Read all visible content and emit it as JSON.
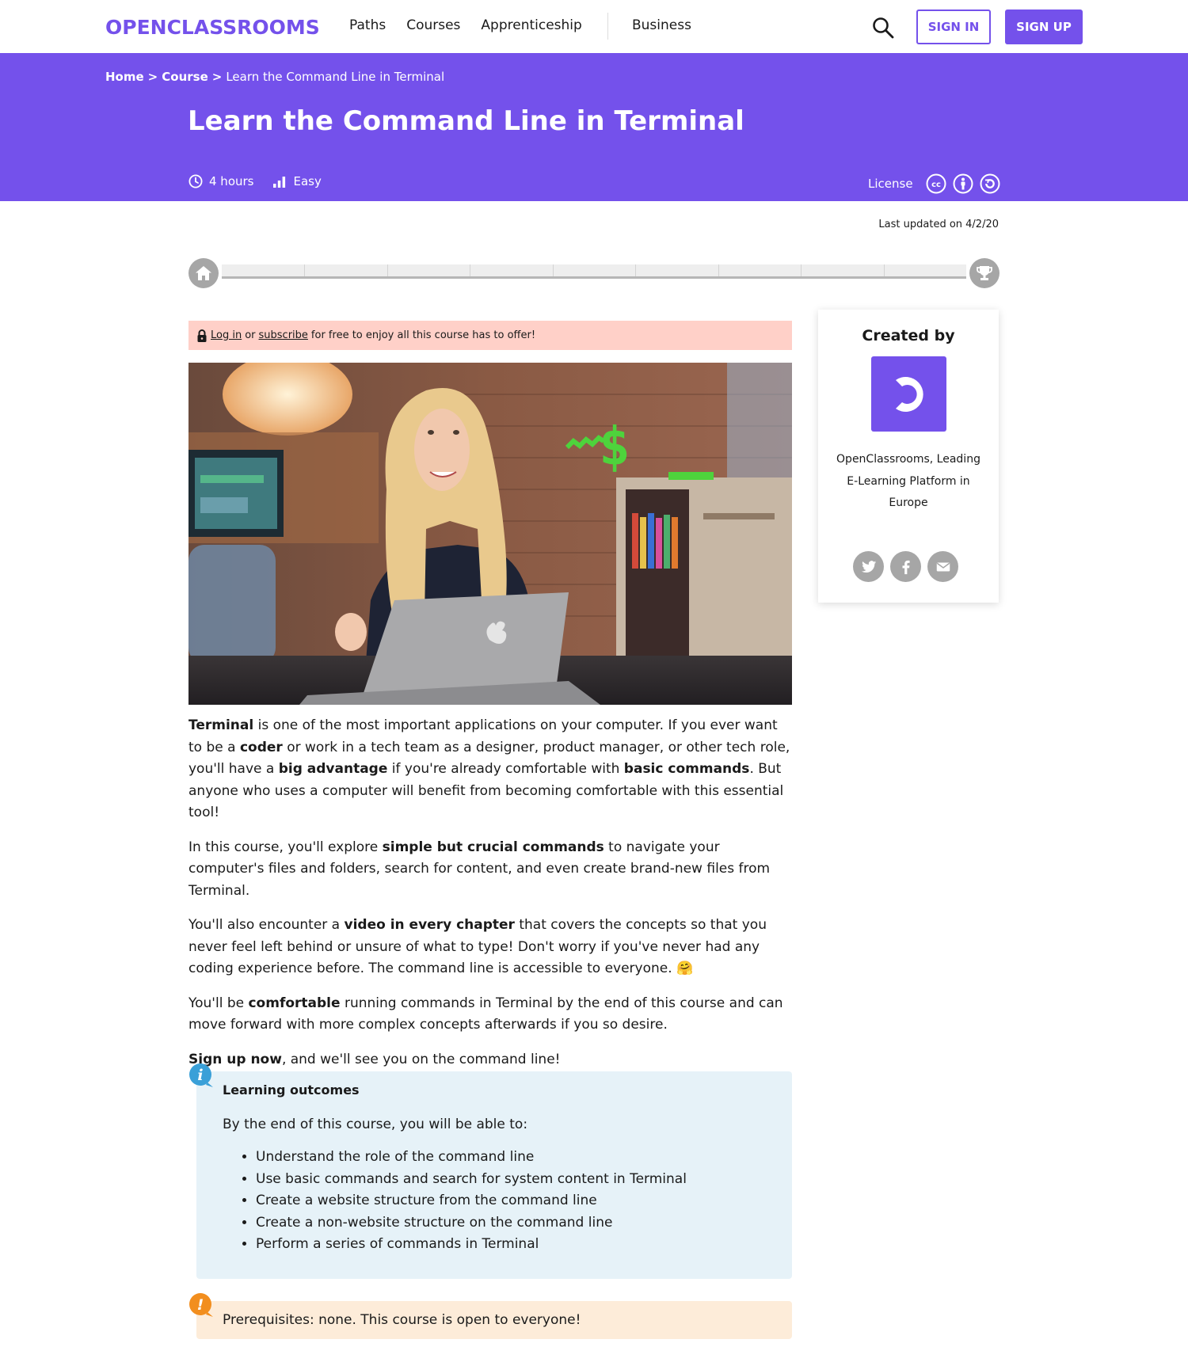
{
  "header": {
    "logo": "OPENCLASSROOMS",
    "nav": [
      "Paths",
      "Courses",
      "Apprenticeship"
    ],
    "business": "Business",
    "search_icon": "search-icon",
    "sign_in": "SIGN IN",
    "sign_up": "SIGN UP"
  },
  "breadcrumb": {
    "home": "Home",
    "separator": ">",
    "course": "Course",
    "current": "Learn the Command Line in Terminal"
  },
  "course": {
    "title": "Learn the Command Line in Terminal",
    "duration": "4 hours",
    "difficulty": "Easy",
    "license_label": "License",
    "license_icons": [
      "cc-icon",
      "attribution-icon",
      "share-alike-icon"
    ],
    "last_updated": "Last updated on 4/2/20",
    "progress_chapters": 9,
    "progress_fraction": 0
  },
  "notice": {
    "login_link": "Log in",
    "or": "or",
    "subscribe_link": "subscribe",
    "rest": "for free to enjoy all this course has to offer!"
  },
  "video": {
    "overlay_text": "~$_"
  },
  "description": {
    "p1": [
      {
        "t": "Terminal",
        "b": true
      },
      {
        "t": " is one of the most important applications on your computer. If you ever want to be a ",
        "b": false
      },
      {
        "t": "coder",
        "b": true
      },
      {
        "t": " or work in a tech team as a designer, product manager, or other tech role, you'll have a ",
        "b": false
      },
      {
        "t": "big advantage",
        "b": true
      },
      {
        "t": " if you're already comfortable with ",
        "b": false
      },
      {
        "t": "basic commands",
        "b": true
      },
      {
        "t": ". But anyone who uses a computer will benefit from becoming comfortable with this essential tool!",
        "b": false
      }
    ],
    "p2": [
      {
        "t": "In this course, you'll explore ",
        "b": false
      },
      {
        "t": "simple but crucial commands",
        "b": true
      },
      {
        "t": " to navigate your computer's files and folders, search for content, and even create brand-new files from Terminal.",
        "b": false
      }
    ],
    "p3": [
      {
        "t": "You'll also encounter a ",
        "b": false
      },
      {
        "t": "video in every chapter",
        "b": true
      },
      {
        "t": " that covers the concepts so that you never feel left behind or unsure of what to type! Don't worry if you've never had any coding experience before. The command line is accessible to everyone. 🤗",
        "b": false
      }
    ],
    "p4": [
      {
        "t": "You'll be ",
        "b": false
      },
      {
        "t": "comfortable",
        "b": true
      },
      {
        "t": " running commands in Terminal by the end of this course and can move forward with more complex concepts afterwards if you so desire.",
        "b": false
      }
    ],
    "p5": [
      {
        "t": "Sign up now",
        "b": true
      },
      {
        "t": ", and we'll see you on the command line!",
        "b": false
      }
    ]
  },
  "outcomes": {
    "title": "Learning outcomes",
    "intro": "By the end of this course, you will be able to:",
    "items": [
      "Understand the role of the command line",
      "Use basic commands and search for system content in Terminal",
      "Create a website structure from the command line",
      "Create a non-website structure on the command line",
      "Perform a series of commands in Terminal"
    ]
  },
  "prerequisites": "Prerequisites: none. This course is open to everyone!",
  "author": {
    "heading": "Created by",
    "name": "OpenClassrooms, Leading E-Learning Platform in Europe",
    "share": [
      "twitter-icon",
      "facebook-icon",
      "email-icon"
    ]
  },
  "colors": {
    "brand": "#7451eb",
    "notice_bg": "#ffd0c8",
    "outcomes_bg": "#e6f2f8",
    "prereq_bg": "#fdecd9",
    "info_badge": "#3aa0d8",
    "warn_badge": "#f28e1e",
    "terminal_green": "#4ed33c"
  }
}
